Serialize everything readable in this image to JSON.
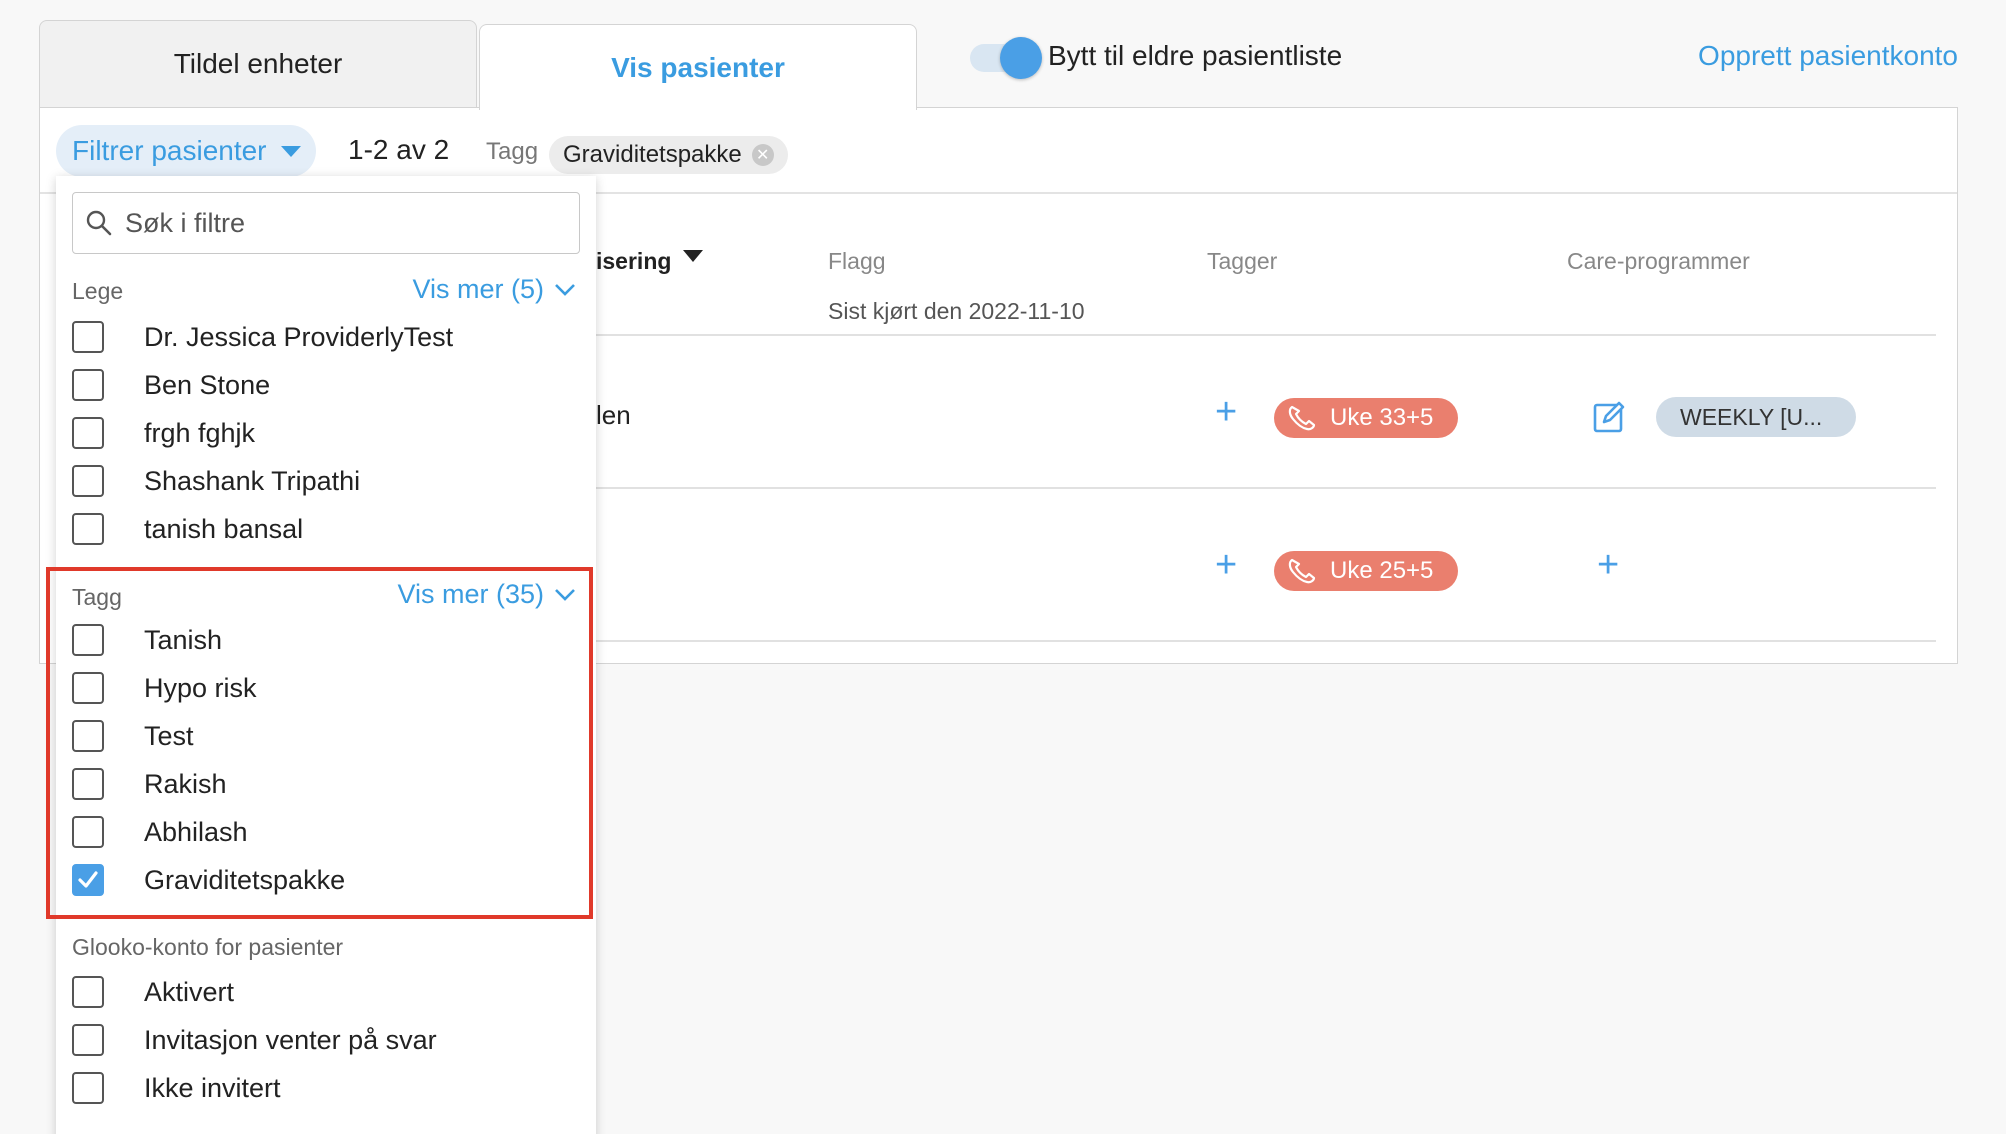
{
  "tabs": [
    {
      "label": "Tildel enheter",
      "active": false
    },
    {
      "label": "Vis pasienter",
      "active": true
    }
  ],
  "toggle": {
    "label": "Bytt til eldre pasientliste",
    "on": true
  },
  "create_link": "Opprett pasientkonto",
  "filter_bar": {
    "button_label": "Filtrer pasienter",
    "count": "1-2 av 2",
    "tag_label": "Tagg",
    "active_tag": "Graviditetspakke"
  },
  "table": {
    "headers": {
      "sort_col": "isering",
      "flagg": "Flagg",
      "flagg_sub": "Sist kjørt den 2022-11-10",
      "tagger": "Tagger",
      "care": "Care-programmer"
    },
    "rows": [
      {
        "text": "len",
        "tag_badge": "Uke 33+5",
        "care_badge": "WEEKLY [U..."
      },
      {
        "text": "",
        "tag_badge": "Uke 25+5",
        "care_badge": ""
      }
    ]
  },
  "dropdown": {
    "search_placeholder": "Søk i filtre",
    "sections": [
      {
        "label": "Lege",
        "more": "Vis mer (5)",
        "options": [
          {
            "label": "Dr. Jessica ProviderlyTest",
            "checked": false
          },
          {
            "label": "Ben Stone",
            "checked": false
          },
          {
            "label": "frgh fghjk",
            "checked": false
          },
          {
            "label": "Shashank Tripathi",
            "checked": false
          },
          {
            "label": "tanish bansal",
            "checked": false
          }
        ]
      },
      {
        "label": "Tagg",
        "more": "Vis mer (35)",
        "options": [
          {
            "label": "Tanish",
            "checked": false
          },
          {
            "label": "Hypo risk",
            "checked": false
          },
          {
            "label": "Test",
            "checked": false
          },
          {
            "label": "Rakish",
            "checked": false
          },
          {
            "label": "Abhilash",
            "checked": false
          },
          {
            "label": "Graviditetspakke",
            "checked": true
          }
        ]
      },
      {
        "label": "Glooko-konto for pasienter",
        "more": "",
        "options": [
          {
            "label": "Aktivert",
            "checked": false
          },
          {
            "label": "Invitasjon venter på svar",
            "checked": false
          },
          {
            "label": "Ikke invitert",
            "checked": false
          }
        ]
      }
    ]
  },
  "colors": {
    "accent": "#3a9ce0",
    "badge_red": "#ea7f6e",
    "highlight": "#e0392a"
  }
}
